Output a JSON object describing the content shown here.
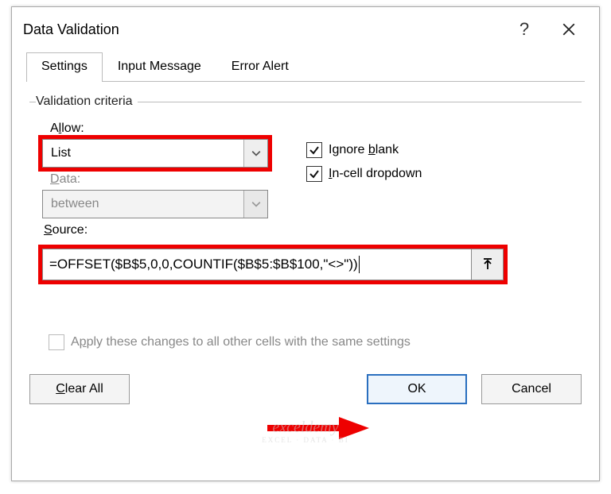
{
  "title": "Data Validation",
  "tabs": {
    "settings": "Settings",
    "input_message": "Input Message",
    "error_alert": "Error Alert"
  },
  "criteria": {
    "legend": "Validation criteria",
    "allow_label_pre": "A",
    "allow_label_u": "l",
    "allow_label_post": "low:",
    "allow_value": "List",
    "data_label_pre": "",
    "data_label_u": "D",
    "data_label_post": "ata:",
    "data_value": "between",
    "source_label_pre": "",
    "source_label_u": "S",
    "source_label_post": "ource:",
    "source_value": "=OFFSET($B$5,0,0,COUNTIF($B$5:$B$100,\"<>\"))",
    "ignore_blank_pre": "Ignore ",
    "ignore_blank_u": "b",
    "ignore_blank_post": "lank",
    "incell_pre": "",
    "incell_u": "I",
    "incell_post": "n-cell dropdown",
    "apply_pre": "A",
    "apply_u": "p",
    "apply_post": "ply these changes to all other cells with the same settings"
  },
  "buttons": {
    "clear_pre": "",
    "clear_u": "C",
    "clear_post": "lear All",
    "ok": "OK",
    "cancel": "Cancel"
  },
  "watermark": "exceldemy",
  "watermark_sub": "EXCEL · DATA · BI"
}
